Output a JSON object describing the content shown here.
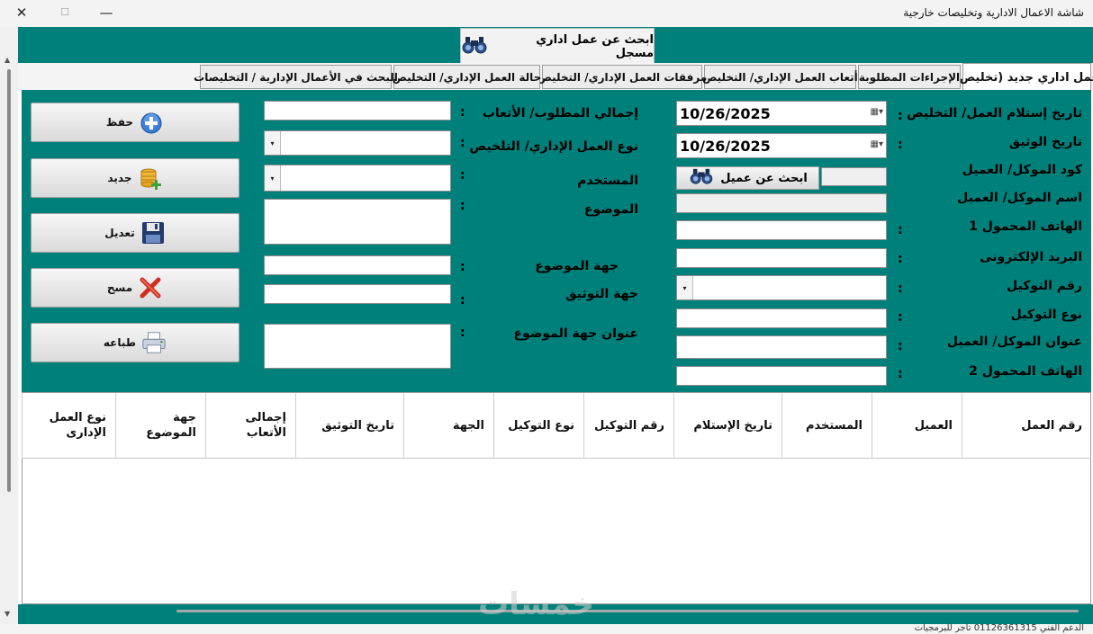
{
  "window": {
    "title": "شاشة الاعمال الادارية وتخليصات خارجية",
    "close_glyph": "✕",
    "maximize_glyph": "☐",
    "minimize_glyph": "—"
  },
  "top_tab": {
    "label": "ابحث عن عمل اداري مسجل",
    "icon": "binoculars-icon"
  },
  "tabs": [
    {
      "label": "عمل اداري جديد (تخليص)",
      "active": true
    },
    {
      "label": "الإجراءات المطلوبة",
      "active": false
    },
    {
      "label": "أتعاب العمل الإداري/ التخليص",
      "active": false
    },
    {
      "label": "مرفقات العمل الإداري/ التخليص",
      "active": false
    },
    {
      "label": "حالة العمل الإداري/ التخليص",
      "active": false
    },
    {
      "label": "البحث في الأعمال الإدارية / التخليصات",
      "active": false
    }
  ],
  "form_right": {
    "receipt_date_label": "تاريخ إستلام العمل/ التخليص",
    "receipt_date_value": "10/26/2025",
    "authentication_date_label": "تاريخ الوثيق",
    "authentication_date_value": "10/26/2025",
    "client_code_label": "كود الموكل/ العميل",
    "client_code_value": "",
    "client_search_button": "ابحث عن عميل",
    "client_name_label": "اسم الموكل/ العميل",
    "client_name_value": "",
    "mobile1_label": "الهاتف المحمول 1",
    "mobile1_value": "",
    "email_label": "البريد الإلكترونى",
    "email_value": "",
    "poa_number_label": "رقم التوكيل",
    "poa_number_value": "",
    "poa_type_label": "نوع التوكيل",
    "poa_type_value": "",
    "client_address_label": "عنوان الموكل/ العميل",
    "client_address_value": "",
    "mobile2_label": "الهاتف المحمول 2",
    "mobile2_value": ""
  },
  "form_middle": {
    "total_fees_label": "إجمالي المطلوب/ الأتعاب",
    "total_fees_value": "",
    "work_type_label": "نوع العمل الإداري/ التلخيص",
    "work_type_value": "",
    "user_label": "المستخدم",
    "user_value": "",
    "subject_label": "الموضوع",
    "subject_value": "",
    "subject_entity_label": "جهة الموضوع",
    "subject_entity_value": "",
    "auth_entity_label": "جهة التوثيق",
    "auth_entity_value": "",
    "subject_entity_address_label": "عنوان جهة الموضوع",
    "subject_entity_address_value": ""
  },
  "colon": ":",
  "dropdown_glyph": "▾",
  "actions": [
    {
      "label": "حفظ",
      "icon": "add-circle-icon"
    },
    {
      "label": "جديد",
      "icon": "database-add-icon"
    },
    {
      "label": "تعديل",
      "icon": "floppy-disk-icon"
    },
    {
      "label": "مسح",
      "icon": "delete-x-icon"
    },
    {
      "label": "طباعه",
      "icon": "printer-icon"
    }
  ],
  "grid": {
    "columns": [
      "رقم العمل",
      "العميل",
      "المستخدم",
      "تاريخ الإستلام",
      "رقم التوكيل",
      "نوع التوكيل",
      "الجهة",
      "تاريخ التوثيق",
      "إجمالى الأتعاب",
      "جهة الموضوع",
      "نوع العمل الإدارى"
    ],
    "rows": []
  },
  "statusbar": {
    "text": "الدعم الفني 01126361315     تاجر للبرمجيات"
  },
  "watermark": "خمسات",
  "colors": {
    "teal": "#00807a",
    "tab_bg": "#ececec"
  }
}
